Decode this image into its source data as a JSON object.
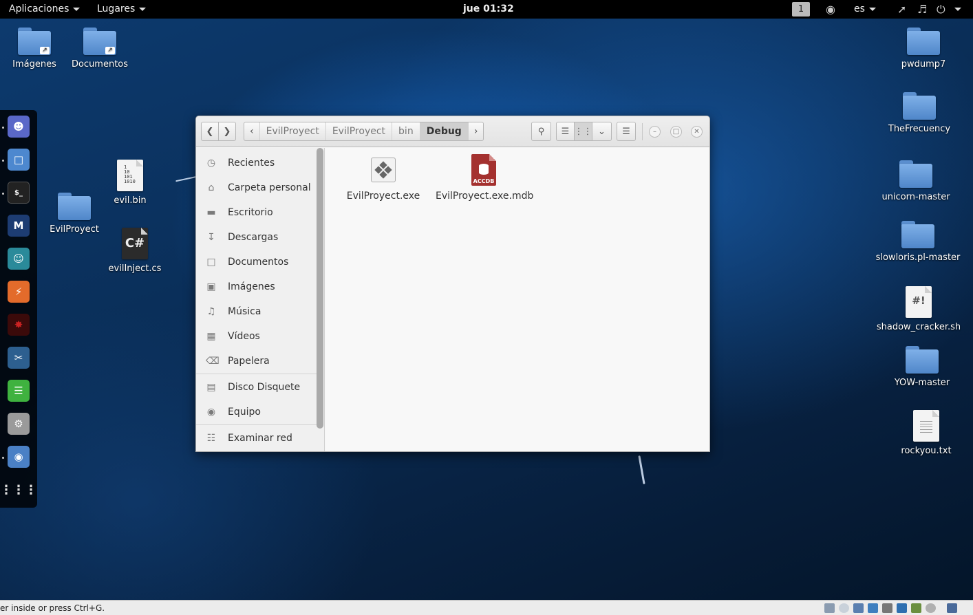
{
  "topbar": {
    "applications": "Aplicaciones",
    "places": "Lugares",
    "clock": "jue 01:32",
    "workspace": "1",
    "language": "es"
  },
  "desktop_icons": {
    "left": [
      {
        "label": "Imágenes",
        "type": "folder-link"
      },
      {
        "label": "Documentos",
        "type": "folder-link"
      },
      {
        "label": "evil.bin",
        "type": "binary"
      },
      {
        "label": "EvilProyect",
        "type": "folder"
      },
      {
        "label": "evilInject.cs",
        "type": "csharp"
      }
    ],
    "right": [
      {
        "label": "pwdump7",
        "type": "folder"
      },
      {
        "label": "TheFrecuency",
        "type": "folder"
      },
      {
        "label": "unicorn-master",
        "type": "folder"
      },
      {
        "label": "slowloris.pl-master",
        "type": "folder"
      },
      {
        "label": "shadow_cracker.sh",
        "type": "script"
      },
      {
        "label": "YOW-master",
        "type": "folder"
      },
      {
        "label": "rockyou.txt",
        "type": "text"
      }
    ]
  },
  "icon_glyphs": {
    "csharp": "C#",
    "script": "#!",
    "binary": [
      "1",
      "10",
      "101",
      "1010"
    ]
  },
  "dock": [
    "pidgin-icon",
    "files-icon",
    "terminal-icon",
    "metasploit-icon",
    "armitage-icon",
    "burpsuite-icon",
    "faraday-icon",
    "maltego-icon",
    "text-editor-icon",
    "settings-icon",
    "remote-icon",
    "show-apps-icon"
  ],
  "file_manager": {
    "breadcrumbs": [
      "EvilProyect",
      "EvilProyect",
      "bin",
      "Debug"
    ],
    "sidebar": [
      {
        "label": "Recientes",
        "icon": "clock-icon"
      },
      {
        "label": "Carpeta personal",
        "icon": "home-icon"
      },
      {
        "label": "Escritorio",
        "icon": "desktop-folder-icon"
      },
      {
        "label": "Descargas",
        "icon": "download-icon"
      },
      {
        "label": "Documentos",
        "icon": "document-icon"
      },
      {
        "label": "Imágenes",
        "icon": "image-icon"
      },
      {
        "label": "Música",
        "icon": "music-icon"
      },
      {
        "label": "Vídeos",
        "icon": "video-icon"
      },
      {
        "label": "Papelera",
        "icon": "trash-icon"
      },
      {
        "label": "Disco Disquete",
        "icon": "floppy-icon"
      },
      {
        "label": "Equipo",
        "icon": "computer-icon"
      },
      {
        "label": "Examinar red",
        "icon": "network-icon"
      }
    ],
    "files": [
      {
        "name": "EvilProyect.exe",
        "type": "executable"
      },
      {
        "name": "EvilProyect.exe.mdb",
        "type": "access-database",
        "badge": "ACCDB"
      }
    ]
  },
  "statusbar": {
    "message": "er inside or press Ctrl+G."
  }
}
